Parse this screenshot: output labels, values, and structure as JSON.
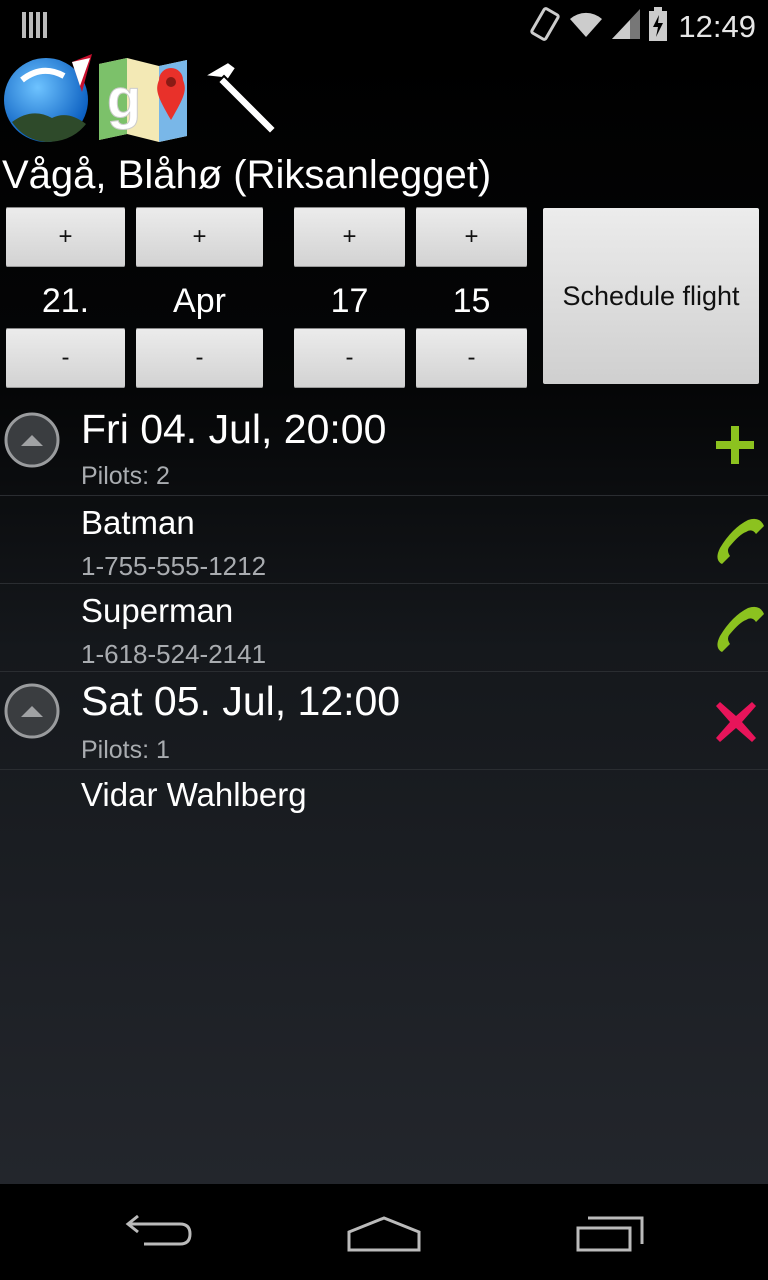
{
  "status_bar": {
    "time": "12:49"
  },
  "app_icons": [
    {
      "name": "paragliding-app-icon"
    },
    {
      "name": "google-maps-icon"
    },
    {
      "name": "hammer-icon"
    }
  ],
  "site": {
    "title": "Vågå, Blåhø (Riksanlegget)"
  },
  "picker": {
    "plus_label": "+",
    "minus_label": "-",
    "day": "21.",
    "month": "Apr",
    "hour": "17",
    "minute": "15",
    "schedule_label": "Schedule flight"
  },
  "flights": [
    {
      "date": "Fri 04. Jul, 20:00",
      "pilots_label": "Pilots: 2",
      "action_icon": "add-icon",
      "pilots": [
        {
          "name": "Batman",
          "phone": "1-755-555-1212"
        },
        {
          "name": "Superman",
          "phone": "1-618-524-2141"
        }
      ]
    },
    {
      "date": "Sat 05. Jul, 12:00",
      "pilots_label": "Pilots: 1",
      "action_icon": "remove-icon",
      "pilots": [
        {
          "name": "Vidar Wahlberg",
          "phone": ""
        }
      ]
    }
  ],
  "colors": {
    "add": "#8cc21f",
    "remove": "#e8145a",
    "call": "#8cc21f"
  }
}
